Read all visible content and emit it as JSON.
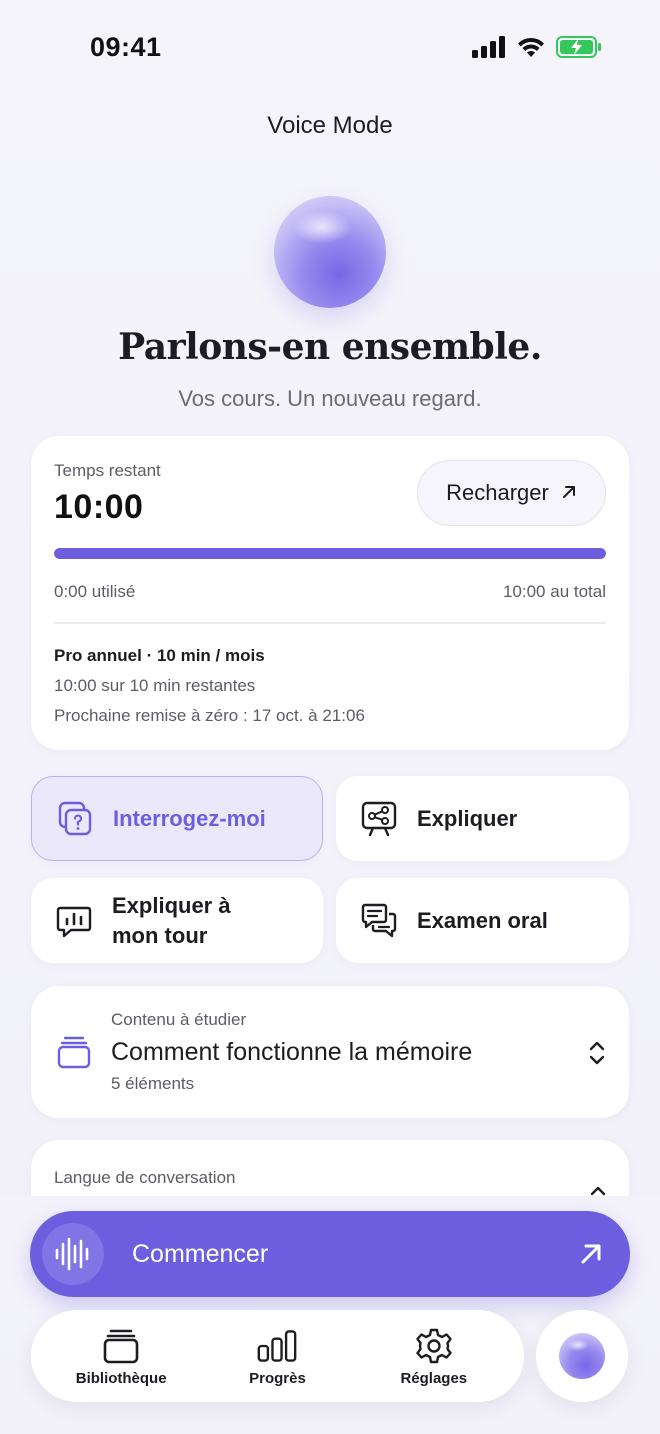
{
  "status_bar": {
    "time": "09:41"
  },
  "header": {
    "title": "Voice Mode"
  },
  "hero": {
    "headline": "Parlons-en ensemble.",
    "subtitle": "Vos cours. Un nouveau regard."
  },
  "usage": {
    "remaining_label": "Temps restant",
    "remaining_value": "10:00",
    "recharge_label": "Recharger",
    "progress_fraction": 1.0,
    "used_label": "0:00 utilisé",
    "total_label": "10:00 au total",
    "plan_name": "Pro annuel · 10 min / mois",
    "plan_remaining": "10:00 sur 10 min restantes",
    "plan_reset": "Prochaine remise à zéro : 17 oct. à 21:06"
  },
  "modes": [
    {
      "label": "Interrogez-moi",
      "icon": "quiz-icon",
      "selected": true
    },
    {
      "label": "Expliquer",
      "icon": "presentation-icon",
      "selected": false
    },
    {
      "label": "Expliquer à mon tour",
      "icon": "chart-bubble-icon",
      "selected": false
    },
    {
      "label": "Examen oral",
      "icon": "chat-bubbles-icon",
      "selected": false
    }
  ],
  "content": {
    "caption": "Contenu à étudier",
    "title": "Comment fonctionne la mémoire",
    "count": "5 éléments"
  },
  "language": {
    "caption": "Langue de conversation"
  },
  "start": {
    "label": "Commencer"
  },
  "tabbar": {
    "items": [
      {
        "label": "Bibliothèque",
        "icon": "library-icon"
      },
      {
        "label": "Progrès",
        "icon": "bar-chart-icon"
      },
      {
        "label": "Réglages",
        "icon": "gear-icon"
      }
    ]
  },
  "colors": {
    "accent": "#6d5ee0",
    "background": "#f4f3fa",
    "battery": "#34c759"
  }
}
